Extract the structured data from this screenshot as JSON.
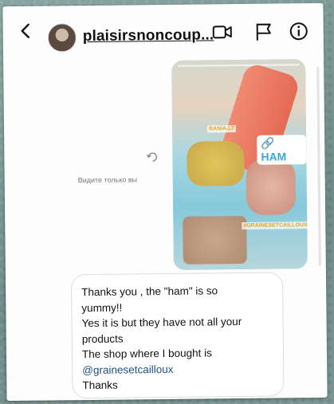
{
  "header": {
    "username": "plaisirsnoncoup...",
    "icons": [
      "back-chevron-icon",
      "video-call-icon",
      "flag-icon",
      "info-icon"
    ]
  },
  "story": {
    "tag_label": "HAM",
    "overlay_texts": [
      "BANIA.LT",
      "#GRAINESETCAILLOUX"
    ]
  },
  "seen_label": "Видите только вы",
  "message": {
    "lines": [
      "Thanks you , the \"ham\" is so",
      "yummy!!",
      "Yes it is but they have not all your",
      "products",
      "The shop where I bought is",
      "@grainesetcailloux",
      "Thanks"
    ]
  },
  "colors": {
    "mention": "#1b4f86",
    "tag_text": "#3aa8d8"
  }
}
